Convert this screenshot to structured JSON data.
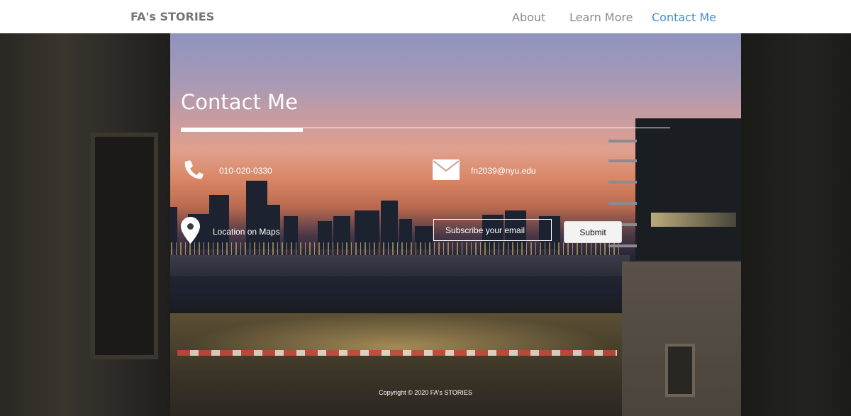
{
  "navbar": {
    "brand": "FA's STORIES",
    "links": [
      {
        "label": "About"
      },
      {
        "label": "Learn More"
      },
      {
        "label": "Contact Me"
      }
    ],
    "active_color": "#3a8fd6",
    "link_color": "#8a8a8a"
  },
  "contact": {
    "title": "Contact Me",
    "phone": {
      "icon": "phone-icon",
      "text": "010-020-0330"
    },
    "email": {
      "icon": "mail-icon",
      "text": "fn2039@nyu.edu"
    },
    "location": {
      "icon": "map-pin-icon",
      "text": "Location on Maps"
    },
    "subscribe": {
      "placeholder": "Subscribe your email",
      "submit_label": "Submit"
    }
  },
  "footer": {
    "copyright": "Copyright © 2020 FA's STORIES"
  }
}
